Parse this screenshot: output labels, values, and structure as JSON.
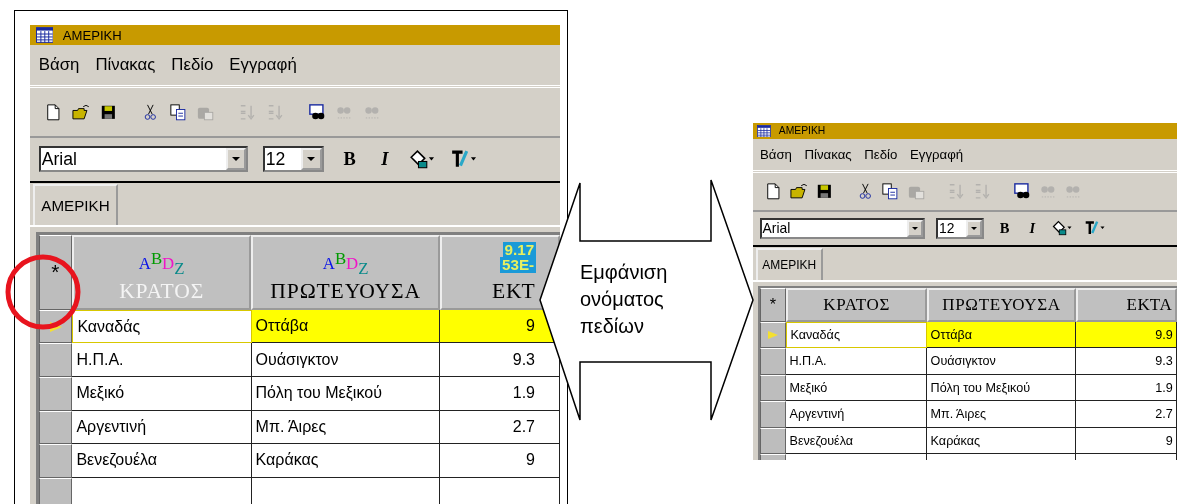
{
  "left_screenshot": {
    "title": "ΑΜΕΡΙΚΗ",
    "menu": [
      "Βάση",
      "Πίνακας",
      "Πεδίο",
      "Εγγραφή"
    ],
    "toolbar": [
      {
        "kind": "new",
        "disabled": false
      },
      {
        "kind": "open",
        "disabled": false
      },
      {
        "kind": "save",
        "disabled": false
      },
      {
        "kind": "cut",
        "disabled": false
      },
      {
        "kind": "copy",
        "disabled": false
      },
      {
        "kind": "paste",
        "disabled": true
      },
      {
        "kind": "sort-asc",
        "disabled": true
      },
      {
        "kind": "sort-desc",
        "disabled": true
      },
      {
        "kind": "find",
        "disabled": false
      },
      {
        "kind": "find-prev",
        "disabled": true
      },
      {
        "kind": "find-next",
        "disabled": true
      }
    ],
    "font": {
      "value": "Arial"
    },
    "size": {
      "value": "12"
    },
    "format_buttons": [
      {
        "kind": "bold",
        "label": "B"
      },
      {
        "kind": "italic",
        "label": "I"
      },
      {
        "kind": "fill-color"
      },
      {
        "kind": "text-color"
      }
    ],
    "tabs": [
      {
        "label": "ΑΜΕΡΙΚΗ",
        "selected": true
      }
    ],
    "table": {
      "new_row_marker": "*",
      "columns": [
        {
          "label": "ΚΡΑΤΟΣ",
          "kind": "text",
          "highlighted": true,
          "type_icon": [
            "A",
            "B",
            "D",
            "Z"
          ]
        },
        {
          "label": "ΠΡΩΤΕΥΟΥΣΑ",
          "kind": "text",
          "highlighted": false,
          "type_icon": [
            "A",
            "B",
            "D",
            "Z"
          ]
        },
        {
          "label": "ΕΚΤ",
          "kind": "number",
          "highlighted": false,
          "type_icon": [
            "9.17",
            "53E-"
          ]
        }
      ],
      "rows": [
        {
          "selected": true,
          "cells": [
            {
              "text": "Καναδάς",
              "focused": true
            },
            {
              "text": "Οττάβα",
              "focused": false
            },
            {
              "text": "9",
              "focused": false
            }
          ]
        },
        {
          "selected": false,
          "cells": [
            {
              "text": "Η.Π.Α.",
              "focused": false
            },
            {
              "text": "Ουάσιγκτον",
              "focused": false
            },
            {
              "text": "9.3",
              "focused": false
            }
          ]
        },
        {
          "selected": false,
          "cells": [
            {
              "text": "Μεξικό",
              "focused": false
            },
            {
              "text": "Πόλη του Μεξικού",
              "focused": false
            },
            {
              "text": "1.9",
              "focused": false
            }
          ]
        },
        {
          "selected": false,
          "cells": [
            {
              "text": "Αργεντινή",
              "focused": false
            },
            {
              "text": "Μπ. Άιρες",
              "focused": false
            },
            {
              "text": "2.7",
              "focused": false
            }
          ]
        },
        {
          "selected": false,
          "cells": [
            {
              "text": "Βενεζουέλα",
              "focused": false
            },
            {
              "text": "Καράκας",
              "focused": false
            },
            {
              "text": "9",
              "focused": false
            }
          ]
        }
      ]
    }
  },
  "callout": {
    "text": "Εμφάνιση ονόματος πεδίων"
  },
  "right_screenshot": {
    "title": "ΑΜΕΡΙΚΗ",
    "menu": [
      "Βάση",
      "Πίνακας",
      "Πεδίο",
      "Εγγραφή"
    ],
    "toolbar": [
      {
        "kind": "new",
        "disabled": false
      },
      {
        "kind": "open",
        "disabled": false
      },
      {
        "kind": "save",
        "disabled": false
      },
      {
        "kind": "cut",
        "disabled": false
      },
      {
        "kind": "copy",
        "disabled": false
      },
      {
        "kind": "paste",
        "disabled": true
      },
      {
        "kind": "sort-asc",
        "disabled": true
      },
      {
        "kind": "sort-desc",
        "disabled": true
      },
      {
        "kind": "find",
        "disabled": false
      },
      {
        "kind": "find-prev",
        "disabled": true
      },
      {
        "kind": "find-next",
        "disabled": true
      }
    ],
    "font": {
      "value": "Arial"
    },
    "size": {
      "value": "12"
    },
    "format_buttons": [
      {
        "kind": "bold",
        "label": "B"
      },
      {
        "kind": "italic",
        "label": "I"
      },
      {
        "kind": "fill-color"
      },
      {
        "kind": "text-color"
      }
    ],
    "tabs": [
      {
        "label": "ΑΜΕΡΙΚΗ",
        "selected": true
      }
    ],
    "table": {
      "new_row_marker": "*",
      "columns": [
        {
          "label": "ΚΡΑΤΟΣ",
          "kind": "text",
          "highlighted": false
        },
        {
          "label": "ΠΡΩΤΕΥΟΥΣΑ",
          "kind": "text",
          "highlighted": false
        },
        {
          "label": "ΕΚΤΑ",
          "kind": "number",
          "highlighted": false
        }
      ],
      "rows": [
        {
          "selected": true,
          "cells": [
            {
              "text": "Καναδάς",
              "focused": true
            },
            {
              "text": "Οττάβα",
              "focused": false
            },
            {
              "text": "9.9",
              "focused": false
            }
          ]
        },
        {
          "selected": false,
          "cells": [
            {
              "text": "Η.Π.Α.",
              "focused": false
            },
            {
              "text": "Ουάσιγκτον",
              "focused": false
            },
            {
              "text": "9.3",
              "focused": false
            }
          ]
        },
        {
          "selected": false,
          "cells": [
            {
              "text": "Μεξικό",
              "focused": false
            },
            {
              "text": "Πόλη του Μεξικού",
              "focused": false
            },
            {
              "text": "1.9",
              "focused": false
            }
          ]
        },
        {
          "selected": false,
          "cells": [
            {
              "text": "Αργεντινή",
              "focused": false
            },
            {
              "text": "Μπ. Άιρες",
              "focused": false
            },
            {
              "text": "2.7",
              "focused": false
            }
          ]
        },
        {
          "selected": false,
          "cells": [
            {
              "text": "Βενεζουέλα",
              "focused": false
            },
            {
              "text": "Καράκας",
              "focused": false
            },
            {
              "text": "9",
              "focused": false
            }
          ]
        }
      ]
    }
  }
}
